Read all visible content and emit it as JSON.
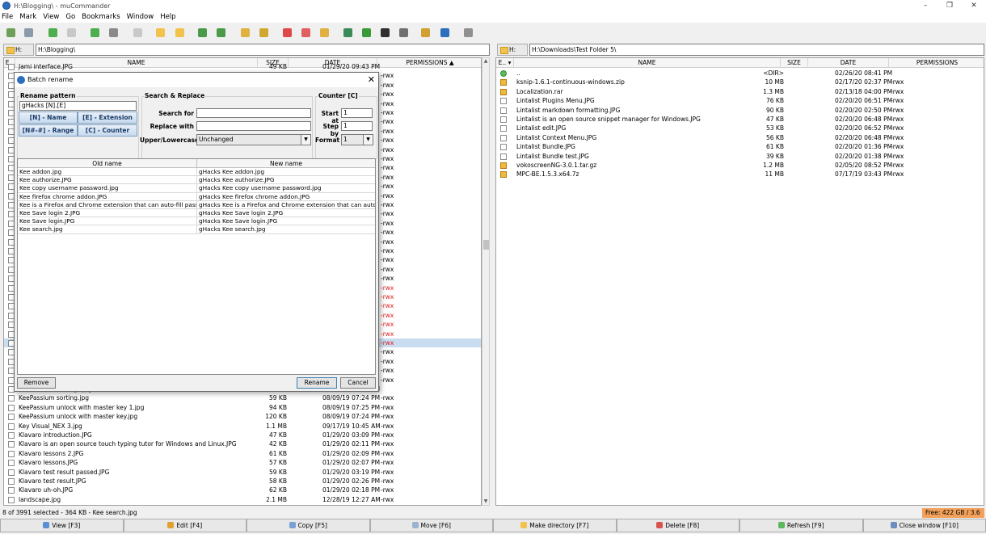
{
  "window": {
    "title": "H:\\Blogging\\ - muCommander",
    "minimize": "–",
    "maximize": "❐",
    "close": "✕"
  },
  "menu": [
    "File",
    "Mark",
    "View",
    "Go",
    "Bookmarks",
    "Window",
    "Help"
  ],
  "left_panel": {
    "drive": "H:",
    "path": "H:\\Blogging\\",
    "columns": {
      "ext": "E..",
      "name": "NAME",
      "size": "SIZE",
      "date": "DATE",
      "perms": "PERMISSIONS ▲"
    },
    "partial_top": {
      "name": "Jami interface.JPG",
      "size": "49 KB",
      "date": "01/29/20 09:43 PM"
    },
    "hidden_perms": [
      "-rwx",
      "-rwx",
      "-rwx",
      "-rwx",
      "-rwx",
      "-rwx",
      "-rwx",
      "-rwx",
      "-rwx",
      "-rwx",
      "-rwx",
      "-rwx",
      "-rwx",
      "-rwx",
      "-rwx",
      "-rwx",
      "-rwx",
      "-rwx",
      "-rwx",
      "-rwx",
      "-rwx",
      "-rwx",
      "-rwx",
      "-rwx",
      "-rwx",
      "-rwx",
      "-rwx",
      "-rwx",
      "-rwx",
      "-rwx",
      "-rwx",
      "-rwx",
      "-rwx",
      "-rwx"
    ],
    "red_perm_rows": [
      23,
      24,
      25,
      26,
      27,
      28,
      29
    ],
    "selected_perm_row": 29,
    "partial_bottom": {
      "name": "KeePassium settings.jpg",
      "size": "49 KB",
      "date": "08/09/19 07:23 PM"
    },
    "rows": [
      {
        "name": "KeePassium sorting.jpg",
        "size": "59 KB",
        "date": "08/09/19 07:24 PM",
        "perms": "-rwx"
      },
      {
        "name": "KeePassium unlock with master key 1.jpg",
        "size": "94 KB",
        "date": "08/09/19 07:25 PM",
        "perms": "-rwx"
      },
      {
        "name": "KeePassium unlock with master key.jpg",
        "size": "120 KB",
        "date": "08/09/19 07:24 PM",
        "perms": "-rwx"
      },
      {
        "name": "Key Visual_NEX 3.jpg",
        "size": "1.1 MB",
        "date": "09/17/19 10:45 AM",
        "perms": "-rwx"
      },
      {
        "name": "Klavaro introduction.JPG",
        "size": "47 KB",
        "date": "01/29/20 03:09 PM",
        "perms": "-rwx"
      },
      {
        "name": "Klavaro is an open source touch typing tutor for Windows and Linux.JPG",
        "size": "42 KB",
        "date": "01/29/20 02:11 PM",
        "perms": "-rwx"
      },
      {
        "name": "Klavaro lessons 2.JPG",
        "size": "61 KB",
        "date": "01/29/20 02:09 PM",
        "perms": "-rwx"
      },
      {
        "name": "Klavaro lessons.JPG",
        "size": "57 KB",
        "date": "01/29/20 02:07 PM",
        "perms": "-rwx"
      },
      {
        "name": "Klavaro test result passed.JPG",
        "size": "59 KB",
        "date": "01/29/20 03:19 PM",
        "perms": "-rwx"
      },
      {
        "name": "Klavaro test result.JPG",
        "size": "58 KB",
        "date": "01/29/20 02:26 PM",
        "perms": "-rwx"
      },
      {
        "name": "Klavaro uh-oh.JPG",
        "size": "62 KB",
        "date": "01/29/20 02:18 PM",
        "perms": "-rwx"
      },
      {
        "name": "landscape.jpg",
        "size": "2.1 MB",
        "date": "12/28/19 12:27 AM",
        "perms": "-rwx"
      }
    ]
  },
  "right_panel": {
    "drive": "H:",
    "path": "H:\\Downloads\\Test Folder 5\\",
    "columns": {
      "ext": "E.. ▾",
      "name": "NAME",
      "size": "SIZE",
      "date": "DATE",
      "perms": "PERMISSIONS"
    },
    "rows": [
      {
        "type": "up",
        "name": "..",
        "size": "<DIR>",
        "date": "02/26/20 08:41 PM",
        "perms": ""
      },
      {
        "type": "arch",
        "name": "ksnip-1.6.1-continuous-windows.zip",
        "size": "10 MB",
        "date": "02/17/20 02:37 PM",
        "perms": "-rwx"
      },
      {
        "type": "arch",
        "name": "Localization.rar",
        "size": "1.3 MB",
        "date": "02/13/18 04:00 PM",
        "perms": "-rwx"
      },
      {
        "type": "file",
        "name": "Lintalist Plugins Menu.JPG",
        "size": "76 KB",
        "date": "02/20/20 06:51 PM",
        "perms": "-rwx"
      },
      {
        "type": "file",
        "name": "Lintalist markdown formatting.JPG",
        "size": "90 KB",
        "date": "02/20/20 02:50 PM",
        "perms": "-rwx"
      },
      {
        "type": "file",
        "name": "Lintalist is an open source snippet manager for Windows.JPG",
        "size": "47 KB",
        "date": "02/20/20 06:48 PM",
        "perms": "-rwx"
      },
      {
        "type": "file",
        "name": "Lintalist edit.JPG",
        "size": "53 KB",
        "date": "02/20/20 06:52 PM",
        "perms": "-rwx"
      },
      {
        "type": "file",
        "name": "Lintalist Context Menu.JPG",
        "size": "56 KB",
        "date": "02/20/20 06:48 PM",
        "perms": "-rwx"
      },
      {
        "type": "file",
        "name": "Lintalist Bundle.JPG",
        "size": "61 KB",
        "date": "02/20/20 01:36 PM",
        "perms": "-rwx"
      },
      {
        "type": "file",
        "name": "Lintalist Bundle test.JPG",
        "size": "39 KB",
        "date": "02/20/20 01:38 PM",
        "perms": "-rwx"
      },
      {
        "type": "arch",
        "name": "vokoscreenNG-3.0.1.tar.gz",
        "size": "1.2 MB",
        "date": "02/05/20 08:52 PM",
        "perms": "-rwx"
      },
      {
        "type": "arch",
        "name": "MPC-BE.1.5.3.x64.7z",
        "size": "11 MB",
        "date": "07/17/19 03:43 PM",
        "perms": "-rwx"
      }
    ]
  },
  "dialog": {
    "title": "Batch rename",
    "close": "✕",
    "rename_pattern": {
      "label": "Rename pattern",
      "value": "gHacks [N].[E]",
      "buttons": [
        "[N] - Name",
        "[E] - Extension",
        "[N#-#] - Range",
        "[C] - Counter"
      ]
    },
    "search_replace": {
      "label": "Search & Replace",
      "search_for": "Search for",
      "replace_with": "Replace with",
      "case_label": "Upper/Lowercase",
      "case_value": "Unchanged"
    },
    "counter": {
      "label": "Counter [C]",
      "start_at": "Start at",
      "start_value": "1",
      "step_by": "Step by",
      "step_value": "1",
      "format": "Format",
      "format_value": "1"
    },
    "table": {
      "old_header": "Old name",
      "new_header": "New name",
      "rows": [
        {
          "old": "Kee addon.jpg",
          "new": "gHacks Kee addon.jpg"
        },
        {
          "old": "Kee authorize.JPG",
          "new": "gHacks Kee authorize.JPG"
        },
        {
          "old": "Kee copy username password.jpg",
          "new": "gHacks Kee copy username password.jpg"
        },
        {
          "old": "Kee firefox chrome addon.JPG",
          "new": "gHacks Kee firefox chrome addon.JPG"
        },
        {
          "old": "Kee is a Firefox and Chrome extension that can auto-fill pass...",
          "new": "gHacks Kee is a Firefox and Chrome extension that can auto-..."
        },
        {
          "old": "Kee Save login 2.JPG",
          "new": "gHacks Kee Save login 2.JPG"
        },
        {
          "old": "Kee Save login.JPG",
          "new": "gHacks Kee Save login.JPG"
        },
        {
          "old": "Kee search.jpg",
          "new": "gHacks Kee search.jpg"
        }
      ]
    },
    "remove": "Remove",
    "rename": "Rename",
    "cancel": "Cancel"
  },
  "status": {
    "text": "8 of 3991 selected - 364 KB - Kee search.jpg",
    "free": "Free: 422 GB / 3.6 TB"
  },
  "function_keys": [
    {
      "label": "View [F3]",
      "color": "#5a8fd6"
    },
    {
      "label": "Edit [F4]",
      "color": "#e0a030"
    },
    {
      "label": "Copy [F5]",
      "color": "#7aa0d8"
    },
    {
      "label": "Move [F6]",
      "color": "#9bb3d0"
    },
    {
      "label": "Make directory [F7]",
      "color": "#f2c34c"
    },
    {
      "label": "Delete [F8]",
      "color": "#d9534f"
    },
    {
      "label": "Refresh [F9]",
      "color": "#5cb85c"
    },
    {
      "label": "Close window [F10]",
      "color": "#6a8fbf"
    }
  ],
  "toolbar_icons": [
    {
      "name": "new-window-icon",
      "color": "#6fa05a"
    },
    {
      "name": "save-icon",
      "color": "#8a9aaa"
    },
    {
      "name": "back-icon",
      "color": "#4cae4c"
    },
    {
      "name": "stop-icon",
      "color": "#c8c8c8"
    },
    {
      "name": "forward-icon",
      "color": "#4cae4c"
    },
    {
      "name": "home-icon",
      "color": "#8a8a8a"
    },
    {
      "name": "blank-icon",
      "color": "#c8c8c8"
    },
    {
      "name": "folder-add-icon",
      "color": "#f2c34c"
    },
    {
      "name": "folder-open-icon",
      "color": "#f2c34c"
    },
    {
      "name": "swap-icon",
      "color": "#4a9a4a"
    },
    {
      "name": "sync-icon",
      "color": "#4a9a4a"
    },
    {
      "name": "mark-icon",
      "color": "#e0b040"
    },
    {
      "name": "unmark-icon",
      "color": "#d0a830"
    },
    {
      "name": "bookmark-icon",
      "color": "#e04848"
    },
    {
      "name": "bookmark-add-icon",
      "color": "#e06060"
    },
    {
      "name": "key-icon",
      "color": "#e0b040"
    },
    {
      "name": "globe-icon",
      "color": "#3a8a5a"
    },
    {
      "name": "globe2-icon",
      "color": "#3a9a3a"
    },
    {
      "name": "terminal-icon",
      "color": "#303030"
    },
    {
      "name": "email-icon",
      "color": "#707070"
    },
    {
      "name": "edit-icon",
      "color": "#d0a030"
    },
    {
      "name": "info-icon",
      "color": "#2d6fbd"
    },
    {
      "name": "settings-icon",
      "color": "#909090"
    }
  ]
}
